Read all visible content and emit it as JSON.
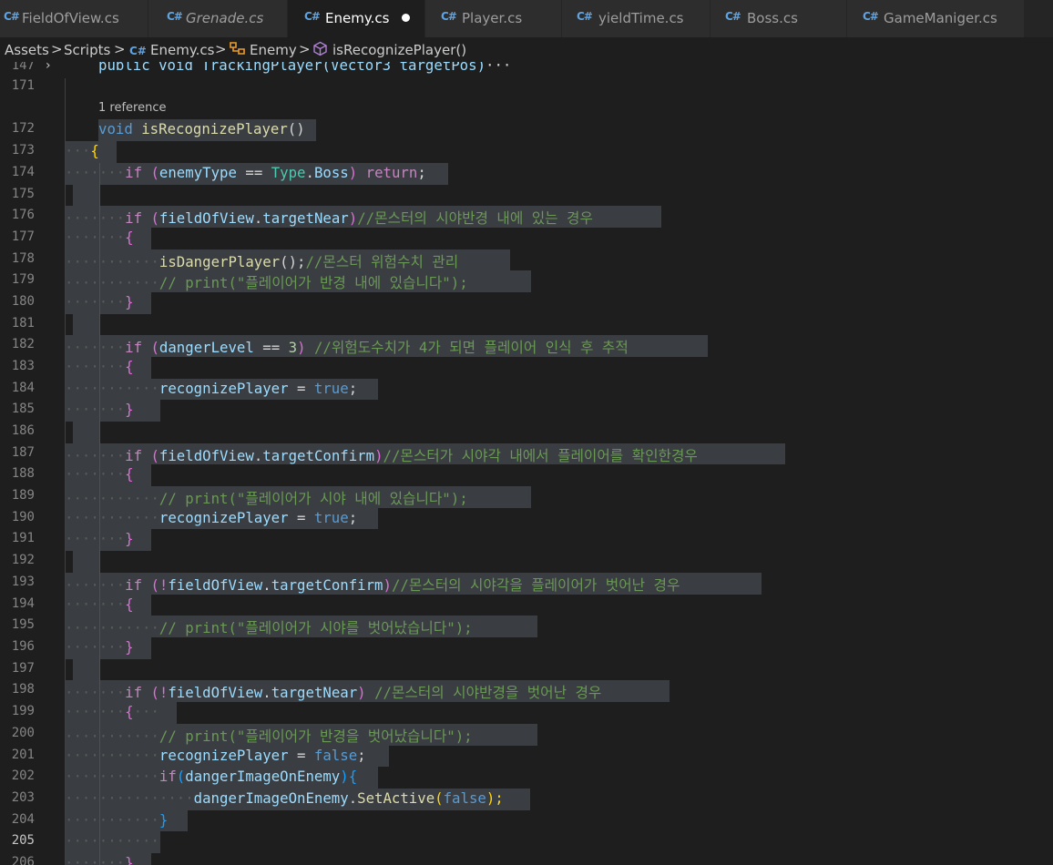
{
  "tabs": [
    {
      "label": "FieldOfView.cs",
      "icon": "C#"
    },
    {
      "label": "Grenade.cs",
      "icon": "C#"
    },
    {
      "label": "Enemy.cs",
      "icon": "C#"
    },
    {
      "label": "Player.cs",
      "icon": "C#"
    },
    {
      "label": "yieldTime.cs",
      "icon": "C#"
    },
    {
      "label": "Boss.cs",
      "icon": "C#"
    },
    {
      "label": "GameManiger.cs",
      "icon": "C#"
    }
  ],
  "breadcrumb": {
    "assets": "Assets",
    "scripts": "Scripts",
    "file": "Enemy.cs",
    "cls": "Enemy",
    "method": "isRecognizePlayer()",
    "sep": ">",
    "cs_icon": "C#",
    "class_icon": "class-icon",
    "method_icon": "method-cube-icon"
  },
  "editor": {
    "folded_line": "147",
    "folded_code": "public void TrackingPlayer(Vector3 targetPos)",
    "folded_ellipsis": "···",
    "codelens": "1 reference",
    "line_numbers": [
      "171",
      "172",
      "173",
      "174",
      "175",
      "176",
      "177",
      "178",
      "179",
      "180",
      "181",
      "182",
      "183",
      "184",
      "185",
      "186",
      "187",
      "188",
      "189",
      "190",
      "191",
      "192",
      "193",
      "194",
      "195",
      "196",
      "197",
      "198",
      "199",
      "200",
      "201",
      "202",
      "203",
      "204",
      "205",
      "206"
    ]
  },
  "code": {
    "l172_kw": "void",
    "l172_fn": "isRecognizePlayer",
    "l172_p": "()",
    "l173": "{",
    "l174_if": "if",
    "l174_a": "(",
    "l174_v": "enemyType",
    "l174_op": " == ",
    "l174_t": "Type",
    "l174_d": ".",
    "l174_b": "Boss",
    "l174_c": ")",
    "l174_ret": "return",
    "l174_e": ";",
    "l176_if": "if",
    "l176_a": "(",
    "l176_v": "fieldOfView",
    "l176_d": ".",
    "l176_p": "targetNear",
    "l176_c": ")",
    "l176_cm": "//몬스터의 시야반경 내에 있는 경우",
    "l177": "{",
    "l178_fn": "isDangerPlayer",
    "l178_p": "();",
    "l178_cm": "//몬스터 위험수치 관리",
    "l179_cm": "// print(\"플레이어가 반경 내에 있습니다\");",
    "l180": "}",
    "l182_if": "if",
    "l182_a": "(",
    "l182_v": "dangerLevel",
    "l182_op": " == ",
    "l182_n": "3",
    "l182_c": ")",
    "l182_cm": "//위험도수치가 4가 되면 플레이어 인식 후 추적",
    "l183": "{",
    "l184_v": "recognizePlayer",
    "l184_op": " = ",
    "l184_k": "true",
    "l184_e": ";",
    "l185": "}",
    "l187_if": "if",
    "l187_a": "(",
    "l187_v": "fieldOfView",
    "l187_d": ".",
    "l187_p": "targetConfirm",
    "l187_c": ")",
    "l187_cm": "//몬스터가 시야각 내에서 플레이어를 확인한경우",
    "l188": "{",
    "l189_cm": "// print(\"플레이어가 시야 내에 있습니다\");",
    "l190_v": "recognizePlayer",
    "l190_op": " = ",
    "l190_k": "true",
    "l190_e": ";",
    "l191": "}",
    "l193_if": "if",
    "l193_a": "(!",
    "l193_v": "fieldOfView",
    "l193_d": ".",
    "l193_p": "targetConfirm",
    "l193_c": ")",
    "l193_cm": "//몬스터의 시야각을 플레이어가 벗어난 경우",
    "l194": "{",
    "l195_cm": "// print(\"플레이어가 시야를 벗어났습니다\");",
    "l196": "}",
    "l198_if": "if",
    "l198_a": "(!",
    "l198_v": "fieldOfView",
    "l198_d": ".",
    "l198_p": "targetNear",
    "l198_c": ")",
    "l198_cm": "//몬스터의 시야반경을 벗어난 경우",
    "l199": "{",
    "l200_cm": "// print(\"플레이어가 반경을 벗어났습니다\");",
    "l201_v": "recognizePlayer",
    "l201_op": " = ",
    "l201_k": "false",
    "l201_e": ";",
    "l202_if": "if",
    "l202_a": "(",
    "l202_v": "dangerImageOnEnemy",
    "l202_c": "){",
    "l203_v": "dangerImageOnEnemy",
    "l203_d": ".",
    "l203_fn": "SetActive",
    "l203_a": "(",
    "l203_k": "false",
    "l203_c": ");",
    "l204": "}",
    "l206": "}"
  }
}
